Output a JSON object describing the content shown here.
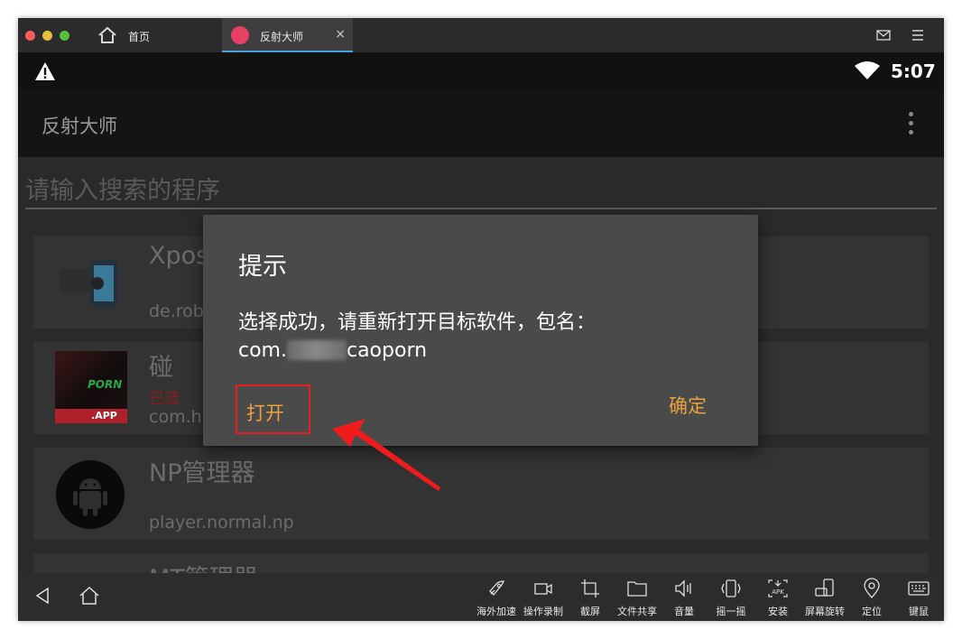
{
  "window": {
    "tabs": [
      {
        "label": "首页"
      },
      {
        "label": "反射大师",
        "close": "×"
      }
    ]
  },
  "status_bar": {
    "time": "5:07"
  },
  "app_bar": {
    "title": "反射大师"
  },
  "search": {
    "placeholder": "请输入搜索的程序"
  },
  "apps": [
    {
      "name": "Xpos",
      "status": "",
      "package": "de.rob"
    },
    {
      "name": "碰",
      "status": "已选",
      "package": "com.h",
      "icon_text": "PORN",
      "icon_sub": ".APP"
    },
    {
      "name": "NP管理器",
      "status": "",
      "package": "player.normal.np"
    },
    {
      "name": "MT管理器",
      "status": "",
      "package": ""
    }
  ],
  "dialog": {
    "title": "提示",
    "message_line1": "选择成功，请重新打开目标软件，包名：",
    "message_prefix": "com.",
    "message_suffix": "caoporn",
    "open_label": "打开",
    "ok_label": "确定"
  },
  "toolbar": [
    {
      "label": "海外加速",
      "icon": "rocket-icon"
    },
    {
      "label": "操作录制",
      "icon": "video-icon"
    },
    {
      "label": "截屏",
      "icon": "crop-icon"
    },
    {
      "label": "文件共享",
      "icon": "folder-icon"
    },
    {
      "label": "音量",
      "icon": "volume-icon"
    },
    {
      "label": "摇一摇",
      "icon": "shake-icon"
    },
    {
      "label": "安装",
      "icon": "apk-icon"
    },
    {
      "label": "屏幕旋转",
      "icon": "rotate-icon"
    },
    {
      "label": "定位",
      "icon": "location-icon"
    },
    {
      "label": "键鼠",
      "icon": "keyboard-icon"
    }
  ],
  "colors": {
    "accent": "#e8a23c",
    "highlight_box": "#e52020",
    "tab_icon": "#e84063"
  }
}
